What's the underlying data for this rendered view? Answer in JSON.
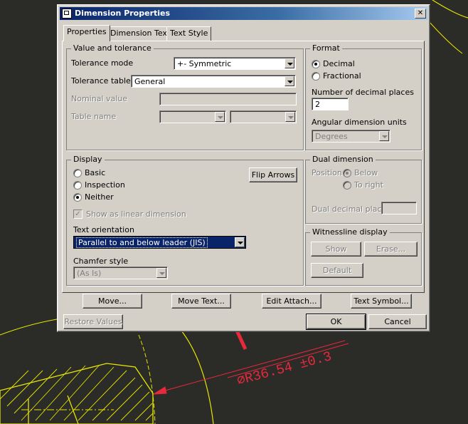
{
  "dialog": {
    "title": "Dimension Properties",
    "close_glyph": "✕"
  },
  "tabs": [
    {
      "label": "Properties",
      "active": true
    },
    {
      "label": "Dimension Text",
      "active": false
    },
    {
      "label": "Text Style",
      "active": false
    }
  ],
  "value_tolerance": {
    "group_label": "Value and tolerance",
    "tolerance_mode_label": "Tolerance mode",
    "tolerance_mode_value": "+- Symmetric",
    "tolerance_table_label": "Tolerance table",
    "tolerance_table_value": "General",
    "nominal_value_label": "Nominal value",
    "table_name_label": "Table name"
  },
  "format": {
    "group_label": "Format",
    "decimal_label": "Decimal",
    "fractional_label": "Fractional",
    "selected": "Decimal",
    "decimal_places_label": "Number of decimal places",
    "decimal_places_value": "2",
    "angular_units_label": "Angular dimension units",
    "angular_units_value": "Degrees"
  },
  "display": {
    "group_label": "Display",
    "basic_label": "Basic",
    "inspection_label": "Inspection",
    "neither_label": "Neither",
    "selected": "Neither",
    "flip_arrows_label": "Flip Arrows",
    "show_linear_label": "Show as linear dimension",
    "show_linear_checked": true,
    "text_orientation_label": "Text orientation",
    "text_orientation_value": "Parallel to and below leader (JIS)",
    "chamfer_style_label": "Chamfer style",
    "chamfer_style_value": "(As Is)"
  },
  "dual_dimension": {
    "group_label": "Dual dimension",
    "position_label": "Position",
    "below_label": "Below",
    "to_right_label": "To right",
    "dual_decimal_places_label": "Dual decimal places"
  },
  "witnessline": {
    "group_label": "Witnessline display",
    "show_label": "Show",
    "erase_label": "Erase...",
    "default_label": "Default"
  },
  "buttons": {
    "move": "Move...",
    "move_text": "Move Text...",
    "edit_attach": "Edit Attach...",
    "text_symbol": "Text Symbol...",
    "restore_values": "Restore Values",
    "ok": "OK",
    "cancel": "Cancel"
  },
  "drawing": {
    "dimension_text": "⌀R36.54 ±0.3",
    "annotation_color": "#e8283c",
    "geometry_color": "#e6e600",
    "background_color": "#2b2b28"
  }
}
